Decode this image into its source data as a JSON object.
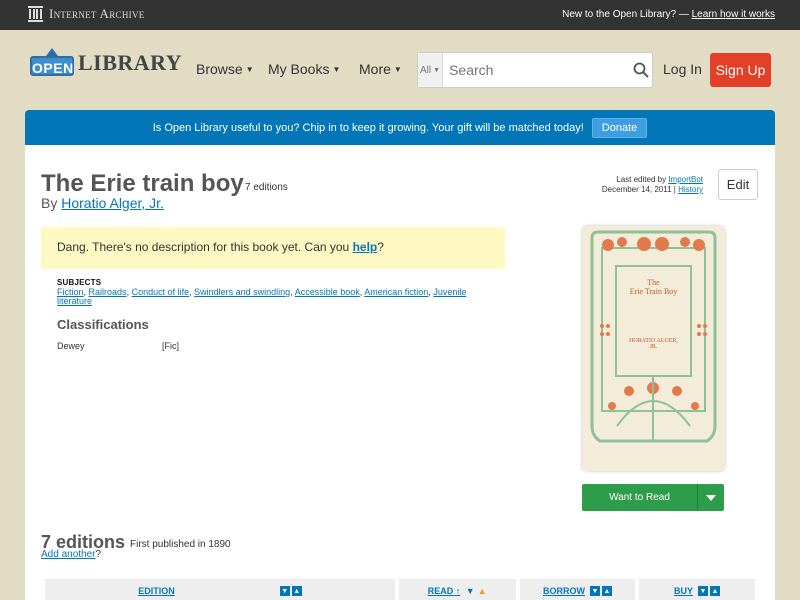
{
  "topbar": {
    "brand": "Internet Archive",
    "prompt": "New to the Open Library? —",
    "learn_link": "Learn how it works"
  },
  "header": {
    "logo_open": "OPEN",
    "logo_library": "LIBRARY",
    "nav": [
      "Browse",
      "My Books",
      "More"
    ],
    "search_scope": "All",
    "search_placeholder": "Search",
    "login": "Log In",
    "signup": "Sign Up"
  },
  "donate": {
    "message": "Is Open Library useful to you? Chip in to keep it growing. Your gift will be matched today!",
    "button": "Donate"
  },
  "book": {
    "title": "The Erie train boy",
    "editions_count": "7 editions",
    "by": "By",
    "author": "Horatio Alger, Jr.",
    "last_edited_prefix": "Last edited by",
    "last_edited_user": "ImportBot",
    "last_edited_date": "December 14, 2011 |",
    "history_link": "History",
    "edit_button": "Edit",
    "no_description": "Dang. There's no description for this book yet. Can you",
    "help_link": "help",
    "help_suffix": "?",
    "subjects_heading": "SUBJECTS",
    "subjects": [
      "Fiction",
      "Railroads",
      "Conduct of life",
      "Swindlers and swindling",
      "Accessible book",
      "American fiction",
      "Juvenile literature"
    ],
    "classifications_heading": "Classifications",
    "dewey_label": "Dewey",
    "dewey_value": "[Fic]",
    "cover_title_line1": "The",
    "cover_title_line2": "Erie Train Boy",
    "cover_author_line1": "HORATIO ALGER,",
    "cover_author_line2": "JR.",
    "want_to_read": "Want to Read"
  },
  "editions": {
    "heading": "7 editions",
    "first_published": "First published in 1890",
    "add_another": "Add another",
    "add_suffix": "?",
    "columns": {
      "edition": "EDITION",
      "read": "READ",
      "borrow": "BORROW",
      "buy": "BUY"
    }
  },
  "colors": {
    "page_bg": "#e2dcc5",
    "topbar": "#333333",
    "link": "#0376b8",
    "donate_bar": "#0376b8",
    "signup": "#e44027",
    "want_to_read": "#2e9d4b",
    "notice_bg": "#fef9c3"
  }
}
